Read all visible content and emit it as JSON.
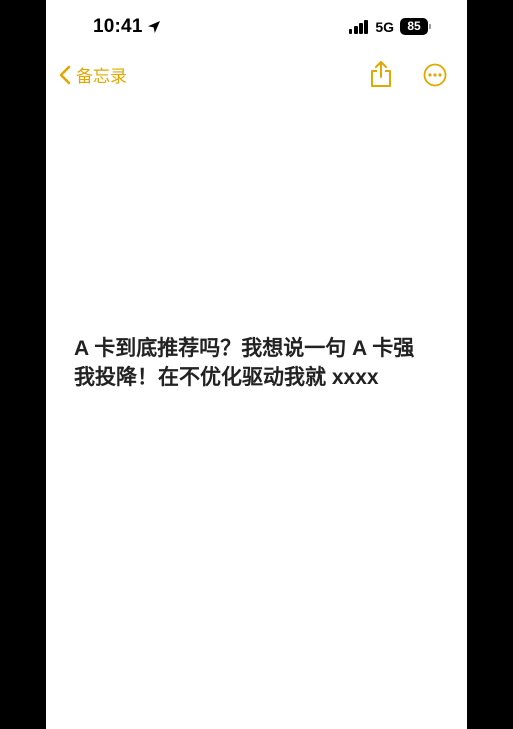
{
  "status_bar": {
    "time": "10:41",
    "network": "5G",
    "battery_level": "85"
  },
  "nav_bar": {
    "back_label": "备忘录"
  },
  "note": {
    "line1": "A 卡到底推荐吗？我想说一句 A 卡强",
    "line2": "我投降！在不优化驱动我就 xxxx"
  },
  "colors": {
    "accent": "#e0a800",
    "text": "#222222",
    "background": "#ffffff"
  },
  "icons": {
    "location": "location-arrow-icon",
    "signal": "cellular-signal-icon",
    "battery": "battery-icon",
    "back": "chevron-left-icon",
    "share": "share-icon",
    "more": "ellipsis-circle-icon"
  }
}
